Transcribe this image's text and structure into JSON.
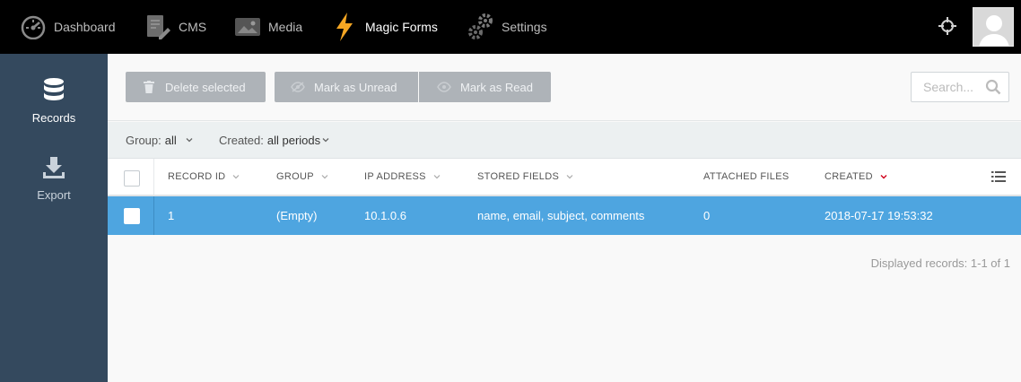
{
  "nav": {
    "items": [
      {
        "label": "Dashboard",
        "icon": "dashboard-icon"
      },
      {
        "label": "CMS",
        "icon": "cms-icon"
      },
      {
        "label": "Media",
        "icon": "media-icon"
      },
      {
        "label": "Magic Forms",
        "icon": "lightning-icon"
      },
      {
        "label": "Settings",
        "icon": "gear-icon"
      }
    ],
    "active": "Magic Forms"
  },
  "sidebar": {
    "items": [
      {
        "label": "Records",
        "icon": "database-icon"
      },
      {
        "label": "Export",
        "icon": "download-icon"
      }
    ]
  },
  "toolbar": {
    "delete_label": "Delete selected",
    "unread_label": "Mark as Unread",
    "read_label": "Mark as Read",
    "search_placeholder": "Search..."
  },
  "filters": {
    "group_label": "Group:",
    "group_value": "all",
    "created_label": "Created:",
    "created_value": "all periods"
  },
  "table": {
    "columns": [
      "RECORD ID",
      "GROUP",
      "IP ADDRESS",
      "STORED FIELDS",
      "ATTACHED FILES",
      "CREATED"
    ],
    "rows": [
      {
        "record_id": "1",
        "group": "(Empty)",
        "ip": "10.1.0.6",
        "fields": "name, email, subject, comments",
        "files": "0",
        "created": "2018-07-17 19:53:32"
      }
    ],
    "footer": "Displayed records: 1-1 of 1"
  },
  "colors": {
    "topbar": "#000000",
    "sidebar": "#34495e",
    "selected_row": "#4ea5e0",
    "accent_lightning": "#f5a623",
    "sort_active": "#d0021b"
  }
}
